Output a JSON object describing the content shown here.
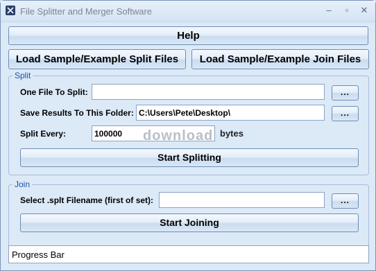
{
  "window": {
    "title": "File Splitter and Merger Software",
    "minimize_glyph": "–",
    "maximize_glyph": "▫",
    "close_glyph": "✕"
  },
  "toolbar": {
    "help_label": "Help",
    "load_split_label": "Load Sample/Example Split Files",
    "load_join_label": "Load Sample/Example Join Files"
  },
  "split": {
    "group_label": "Split",
    "one_file_label": "One File To Split:",
    "one_file_value": "",
    "save_folder_label": "Save Results To This Folder:",
    "save_folder_value": "C:\\Users\\Pete\\Desktop\\",
    "split_every_label": "Split Every:",
    "split_every_value": "100000",
    "split_every_unit": "bytes",
    "browse_label": "...",
    "start_label": "Start Splitting"
  },
  "join": {
    "group_label": "Join",
    "select_label": "Select .splt Filename (first of set):",
    "select_value": "",
    "browse_label": "...",
    "start_label": "Start Joining"
  },
  "progress": {
    "label": "Progress Bar"
  },
  "watermark": {
    "text": "download"
  }
}
